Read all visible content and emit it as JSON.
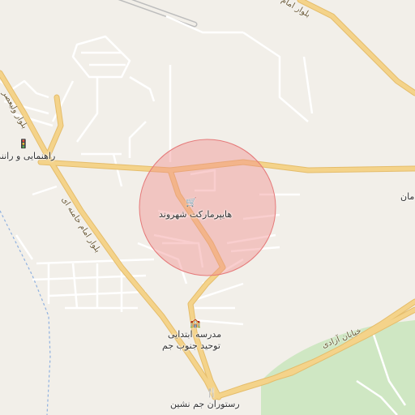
{
  "map": {
    "colors": {
      "background": "#f2efe9",
      "major_road": "#f4d38a",
      "major_road_casing": "#e5bd6b",
      "minor_road": "#ffffff",
      "minor_road_casing": "#d9d4cc",
      "park": "#cfe7c3",
      "runway": "#b9b9b9",
      "water_dash": "#8fb1e0",
      "highlight_fill": "#f08a8a",
      "highlight_stroke": "#e57a7a"
    },
    "highlight_circle": {
      "label": "هایپرمارکت شهروند",
      "icon": "shopping-cart-icon"
    },
    "places": [
      {
        "name": "school",
        "label_line1": "مدرسه ابتدایی",
        "label_line2": "توحید جنوب جم",
        "icon": "school-icon"
      },
      {
        "name": "restaurant",
        "label": "رستوران جم نشین",
        "icon": "fork-knife-icon"
      },
      {
        "name": "driving-school",
        "label": "راهنمایی و رانند",
        "icon": "traffic-light-icon"
      },
      {
        "name": "partial-edge",
        "label": "مان"
      }
    ],
    "roads": [
      {
        "name": "imam-khamenei-blvd",
        "label": "بلوار امام خامنه ای"
      },
      {
        "name": "azadi-street",
        "label": "خیابان آزادی"
      },
      {
        "name": "valiasr-blvd",
        "label": "بلوار ولیعصر"
      },
      {
        "name": "top-blvd",
        "label": "بلوار امام"
      }
    ]
  }
}
